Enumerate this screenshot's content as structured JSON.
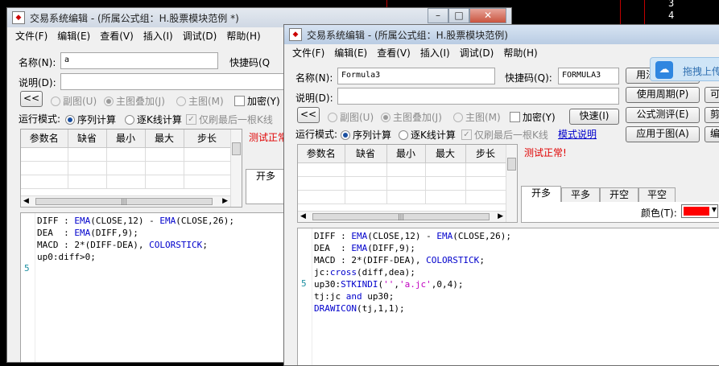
{
  "background": {
    "right_numbers": [
      "3",
      "4"
    ]
  },
  "win_back": {
    "title": "交易系统编辑 - (所属公式组：H.股票模块范例 *)",
    "menu": [
      "文件(F)",
      "编辑(E)",
      "查看(V)",
      "插入(I)",
      "调试(D)",
      "帮助(H)"
    ],
    "name_label": "名称(N):",
    "name_value": "a",
    "hotkey_label": "快捷码(Q",
    "desc_label": "说明(D):",
    "collapse_button": "<<",
    "radio_subchart": "副图(U)",
    "radio_main_overlay": "主图叠加(J)",
    "radio_main": "主图(M)",
    "check_encrypt": "加密(Y)",
    "run_mode_label": "运行模式:",
    "run_sequence": "序列计算",
    "run_kline": "逐K线计算",
    "run_refresh_last": "仅刷最后一根K线",
    "param_headers": [
      "参数名",
      "缺省",
      "最小",
      "最大",
      "步长"
    ],
    "status_text": "测试正常",
    "tab_label": "开多",
    "code_lines": [
      [
        {
          "t": "DIFF : "
        },
        {
          "t": "EMA",
          "c": "kw"
        },
        {
          "t": "(CLOSE,12) - "
        },
        {
          "t": "EMA",
          "c": "kw"
        },
        {
          "t": "(CLOSE,26);"
        }
      ],
      [
        {
          "t": "DEA  : "
        },
        {
          "t": "EMA",
          "c": "kw"
        },
        {
          "t": "(DIFF,9);"
        }
      ],
      [
        {
          "t": "MACD : 2*(DIFF-DEA), "
        },
        {
          "t": "COLORSTICK",
          "c": "kw"
        },
        {
          "t": ";"
        }
      ],
      [
        {
          "t": "up0:diff>0;"
        }
      ],
      [
        {
          "t": ""
        }
      ]
    ],
    "line_marker": "5"
  },
  "win_front": {
    "title": "交易系统编辑 - (所属公式组：H.股票模块范例)",
    "menu": [
      "文件(F)",
      "编辑(E)",
      "查看(V)",
      "插入(I)",
      "调试(D)",
      "帮助(H)"
    ],
    "name_label": "名称(N):",
    "name_value": "Formula3",
    "hotkey_label": "快捷码(Q):",
    "hotkey_value": "FORMULA3",
    "desc_label": "说明(D):",
    "collapse_button": "<<",
    "radio_subchart": "副图(U)",
    "radio_main_overlay": "主图叠加(J)",
    "radio_main": "主图(M)",
    "check_encrypt": "加密(Y)",
    "fast_button": "快速(I)",
    "run_mode_label": "运行模式:",
    "run_sequence": "序列计算",
    "run_kline": "逐K线计算",
    "run_refresh_last": "仅刷最后一根K线",
    "mode_help_link": "模式说明",
    "buttons": [
      "用法注释(R)",
      "使用周期(P)",
      "公式测评(E)",
      "应用于图(A)"
    ],
    "right_edge_buttons": [
      "可",
      "剪",
      "编"
    ],
    "upload_badge": "拖拽上传",
    "param_headers": [
      "参数名",
      "缺省",
      "最小",
      "最大",
      "步长"
    ],
    "status_text": "测试正常!",
    "tabs": [
      "开多",
      "平多",
      "开空",
      "平空"
    ],
    "color_label": "颜色(T):",
    "color_swatch": "#ff0000",
    "code_lines": [
      [
        {
          "t": "DIFF : "
        },
        {
          "t": "EMA",
          "c": "kw"
        },
        {
          "t": "(CLOSE,12) - "
        },
        {
          "t": "EMA",
          "c": "kw"
        },
        {
          "t": "(CLOSE,26);"
        }
      ],
      [
        {
          "t": "DEA  : "
        },
        {
          "t": "EMA",
          "c": "kw"
        },
        {
          "t": "(DIFF,9);"
        }
      ],
      [
        {
          "t": "MACD : 2*(DIFF-DEA), "
        },
        {
          "t": "COLORSTICK",
          "c": "kw"
        },
        {
          "t": ";"
        }
      ],
      [
        {
          "t": "jc:"
        },
        {
          "t": "cross",
          "c": "kw"
        },
        {
          "t": "(diff,dea);"
        }
      ],
      [
        {
          "t": "up30:"
        },
        {
          "t": "STKINDI",
          "c": "kw"
        },
        {
          "t": "("
        },
        {
          "t": "''",
          "c": "str"
        },
        {
          "t": ","
        },
        {
          "t": "'a.jc'",
          "c": "str"
        },
        {
          "t": ",0,4);"
        }
      ],
      [
        {
          "t": "tj:jc "
        },
        {
          "t": "and",
          "c": "kw"
        },
        {
          "t": " up30;"
        }
      ],
      [
        {
          "t": "DRAWICON",
          "c": "kw"
        },
        {
          "t": "(tj,1,1);"
        }
      ]
    ],
    "line_marker": "5"
  }
}
